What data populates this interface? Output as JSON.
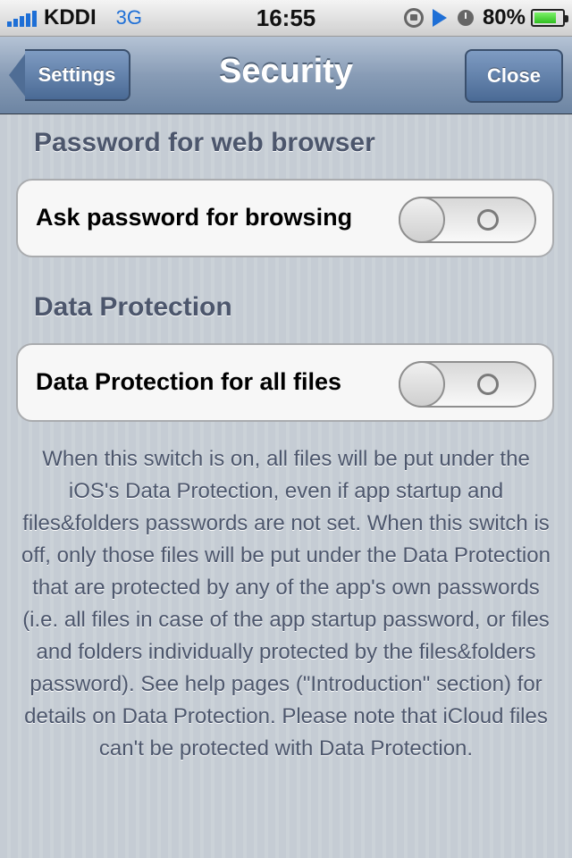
{
  "status_bar": {
    "carrier": "KDDI",
    "network": "3G",
    "time": "16:55",
    "battery_percent": "80%",
    "battery_level": 0.8
  },
  "nav": {
    "back_label": "Settings",
    "title": "Security",
    "close_label": "Close"
  },
  "sections": [
    {
      "header": "Password for web browser",
      "row_label": "Ask password for browsing",
      "switch_on": false
    },
    {
      "header": "Data Protection",
      "row_label": "Data Protection for all files",
      "switch_on": false
    }
  ],
  "footer": "When this switch is on, all files will be put under the iOS's Data Protection, even if app startup and files&folders passwords are not set. When this switch is off, only those files will be put under the Data Protection that are protected by any of the app's own passwords (i.e. all files in case of the app startup password, or files and folders individually protected by the files&folders password). See help pages (\"Introduction\" section) for details on Data Protection. Please note that iCloud files can't be protected with Data Protection."
}
